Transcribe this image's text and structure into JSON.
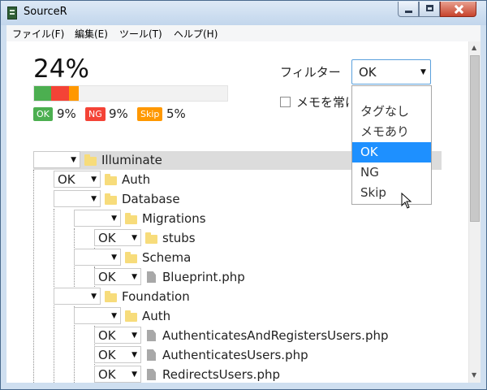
{
  "window": {
    "title": "SourceR"
  },
  "menu": [
    "ファイル(F)",
    "編集(E)",
    "ツール(T)",
    "ヘルプ(H)"
  ],
  "progress": {
    "percent_text": "24%",
    "ok": {
      "label": "OK",
      "value": "9%",
      "color": "#4caf50",
      "fraction": 0.09
    },
    "ng": {
      "label": "NG",
      "value": "9%",
      "color": "#f44336",
      "fraction": 0.09
    },
    "skip": {
      "label": "Skip",
      "value": "5%",
      "color": "#ff9800",
      "fraction": 0.05
    }
  },
  "filter": {
    "label": "フィルター",
    "selected": "OK",
    "options": [
      "",
      "タグなし",
      "メモあり",
      "OK",
      "NG",
      "Skip"
    ],
    "memo_label": "メモを常に表示"
  },
  "tree": [
    {
      "status": "",
      "type": "folder",
      "name": "Illuminate",
      "highlighted": true
    },
    {
      "status": "OK",
      "type": "folder",
      "name": "Auth"
    },
    {
      "status": "",
      "type": "folder",
      "name": "Database"
    },
    {
      "status": "",
      "type": "folder",
      "name": "Migrations"
    },
    {
      "status": "OK",
      "type": "folder",
      "name": "stubs"
    },
    {
      "status": "",
      "type": "folder",
      "name": "Schema"
    },
    {
      "status": "OK",
      "type": "file",
      "name": "Blueprint.php"
    },
    {
      "status": "",
      "type": "folder",
      "name": "Foundation"
    },
    {
      "status": "",
      "type": "folder",
      "name": "Auth"
    },
    {
      "status": "OK",
      "type": "file",
      "name": "AuthenticatesAndRegistersUsers.php"
    },
    {
      "status": "OK",
      "type": "file",
      "name": "AuthenticatesUsers.php"
    },
    {
      "status": "OK",
      "type": "file",
      "name": "RedirectsUsers.php"
    }
  ]
}
